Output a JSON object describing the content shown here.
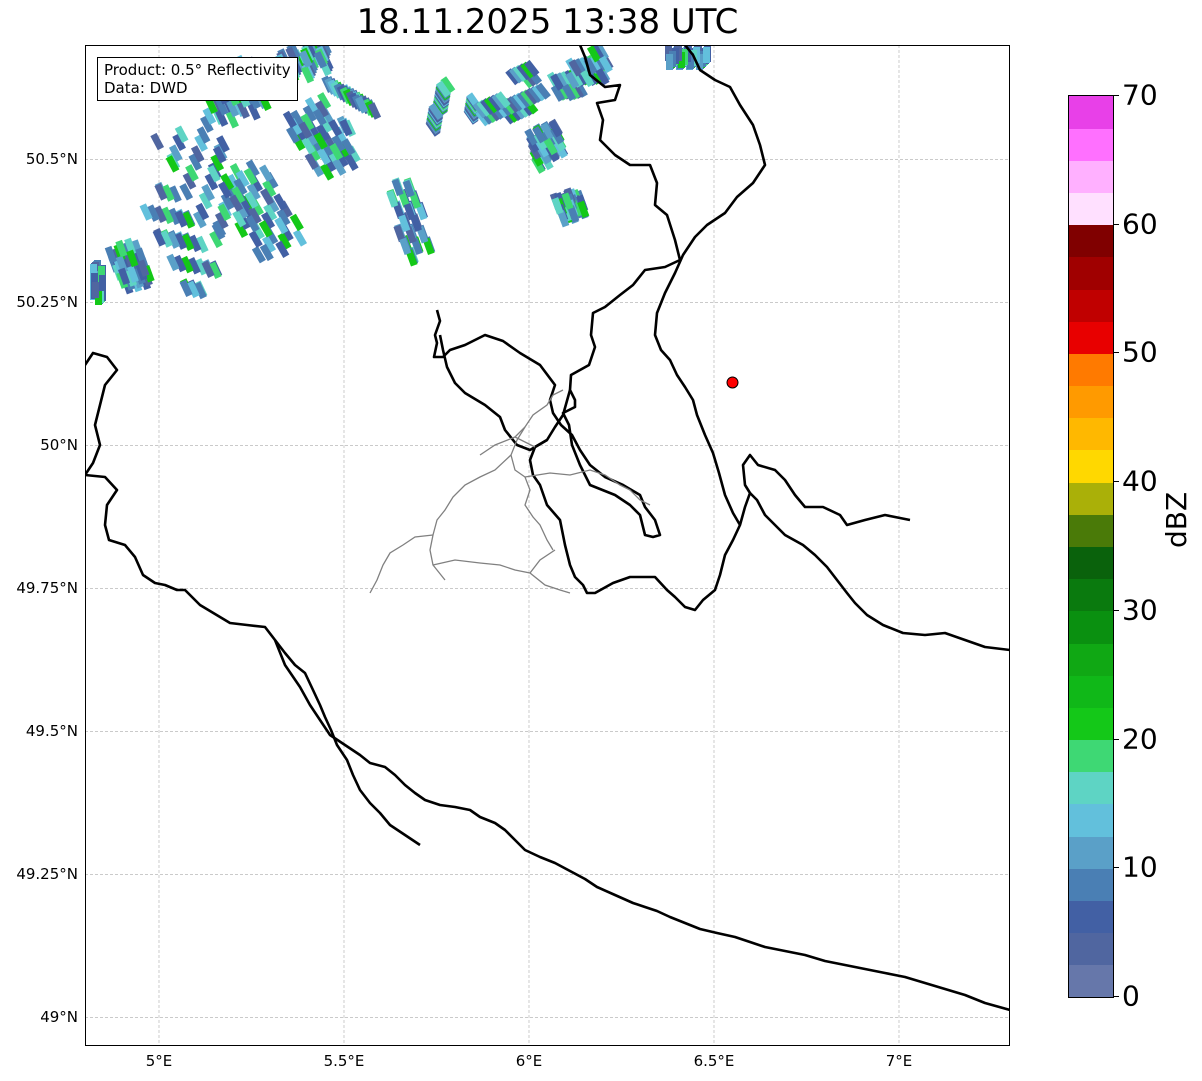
{
  "title": "18.11.2025 13:38 UTC",
  "info": {
    "product": "Product: 0.5° Reflectivity",
    "source": "Data: DWD"
  },
  "map": {
    "lon_range": [
      4.8,
      7.3
    ],
    "lat_range": [
      48.95,
      50.7
    ],
    "lat_ticks": [
      {
        "value": 50.5,
        "label": "50.5°N"
      },
      {
        "value": 50.25,
        "label": "50.25°N"
      },
      {
        "value": 50.0,
        "label": "50°N"
      },
      {
        "value": 49.75,
        "label": "49.75°N"
      },
      {
        "value": 49.5,
        "label": "49.5°N"
      },
      {
        "value": 49.25,
        "label": "49.25°N"
      },
      {
        "value": 49.0,
        "label": "49°N"
      }
    ],
    "lon_ticks": [
      {
        "value": 5.0,
        "label": "5°E"
      },
      {
        "value": 5.5,
        "label": "5.5°E"
      },
      {
        "value": 6.0,
        "label": "6°E"
      },
      {
        "value": 6.5,
        "label": "6.5°E"
      },
      {
        "value": 7.0,
        "label": "7°E"
      }
    ],
    "radar_site": {
      "lon": 6.55,
      "lat": 50.11,
      "color": "#ff0000"
    }
  },
  "colorbar": {
    "label": "dBZ",
    "min": 0,
    "max": 70,
    "step": 2.5,
    "tick_values": [
      0,
      10,
      20,
      30,
      40,
      50,
      60,
      70
    ],
    "tick_labels": [
      "0",
      "10",
      "20",
      "30",
      "40",
      "50",
      "60",
      "70"
    ],
    "colors": [
      "#6677aa",
      "#5066a0",
      "#4260a4",
      "#4a7fb4",
      "#5aa0c8",
      "#62c0dc",
      "#5ed4c4",
      "#3ed874",
      "#14c818",
      "#10b818",
      "#10a814",
      "#0a9010",
      "#0a7a0e",
      "#0a620c",
      "#4a7a08",
      "#aab008",
      "#ffd800",
      "#ffb800",
      "#ff9a00",
      "#ff7a00",
      "#e80000",
      "#c00000",
      "#a00000",
      "#800000",
      "#ffe0ff",
      "#ffb0ff",
      "#ff70ff",
      "#e840e8"
    ]
  }
}
